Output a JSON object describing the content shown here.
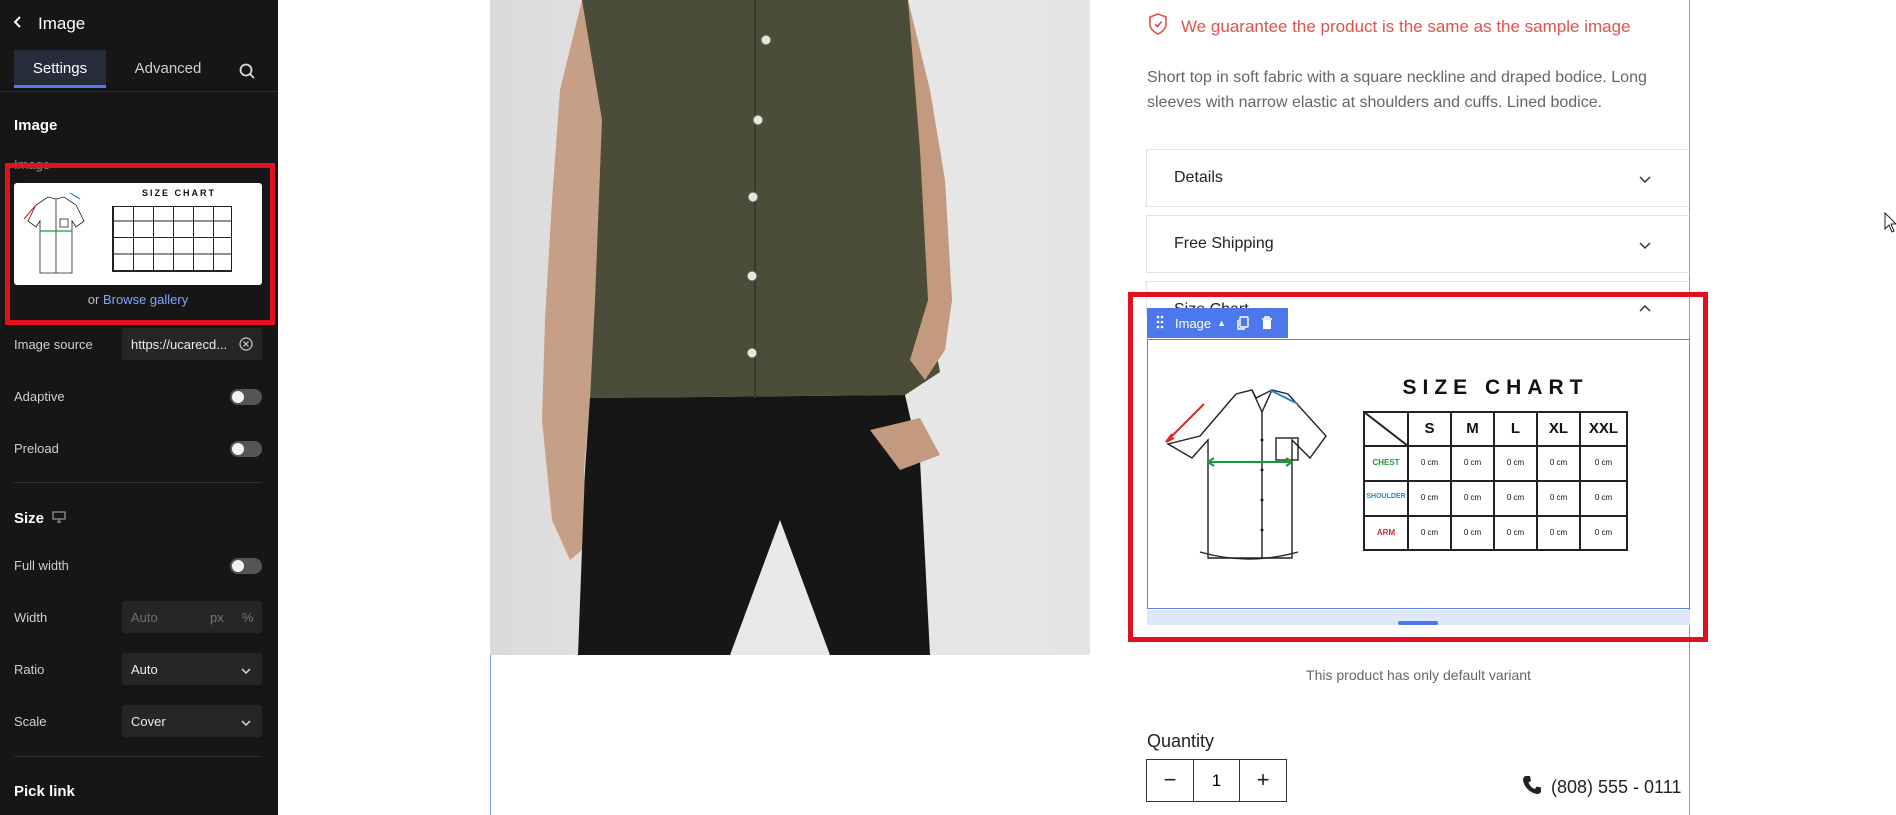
{
  "sidebar": {
    "back_icon": "chevron-left-icon",
    "title": "Image",
    "tabs": [
      {
        "label": "Settings",
        "active": true
      },
      {
        "label": "Advanced",
        "active": false
      }
    ],
    "search_icon": "search-icon",
    "image_section_title": "Image",
    "image_field_label": "Image",
    "browse_prefix": "or",
    "browse_link": "Browse gallery",
    "image_source": {
      "label": "Image source",
      "value": "https://ucarecd..."
    },
    "adaptive": {
      "label": "Adaptive",
      "on": false
    },
    "preload": {
      "label": "Preload",
      "on": false
    },
    "size_section": {
      "title": "Size",
      "icon": "desktop-icon"
    },
    "full_width": {
      "label": "Full width",
      "on": false
    },
    "width": {
      "label": "Width",
      "placeholder": "Auto",
      "unit_px": "px",
      "unit_pct": "%"
    },
    "ratio": {
      "label": "Ratio",
      "value": "Auto"
    },
    "scale": {
      "label": "Scale",
      "value": "Cover"
    },
    "pick_link_title": "Pick link"
  },
  "size_chart": {
    "title": "SIZE CHART",
    "columns": [
      "S",
      "M",
      "L",
      "XL",
      "XXL"
    ],
    "rows": [
      {
        "label": "CHEST",
        "color": "#1b9a3c",
        "values": [
          "0 cm",
          "0 cm",
          "0 cm",
          "0 cm",
          "0 cm"
        ]
      },
      {
        "label": "SHOULDER",
        "color": "#2a86c9",
        "values": [
          "0 cm",
          "0 cm",
          "0 cm",
          "0 cm",
          "0 cm"
        ]
      },
      {
        "label": "ARM",
        "color": "#d52a2a",
        "values": [
          "0 cm",
          "0 cm",
          "0 cm",
          "0 cm",
          "0 cm"
        ]
      }
    ]
  },
  "product": {
    "guarantee": "We guarantee the product is the same as the sample image",
    "description": "Short top in soft fabric with a square neckline and draped bodice. Long sleeves with narrow elastic at shoulders and cuffs. Lined bodice.",
    "accordions": [
      {
        "label": "Details",
        "expanded": false
      },
      {
        "label": "Free Shipping",
        "expanded": false
      },
      {
        "label": "Size Chart",
        "expanded": true
      }
    ],
    "element_tag": "Image",
    "variant_note": "This product has only default variant",
    "quantity_label": "Quantity",
    "quantity_value": "1",
    "quantity_minus": "−",
    "quantity_plus": "+",
    "phone": "(808) 555 - 0111"
  },
  "colors": {
    "accent": "#4d78ec",
    "highlight": "#e0121f",
    "guarantee": "#e0524a",
    "sidebar_bg": "#161616"
  }
}
